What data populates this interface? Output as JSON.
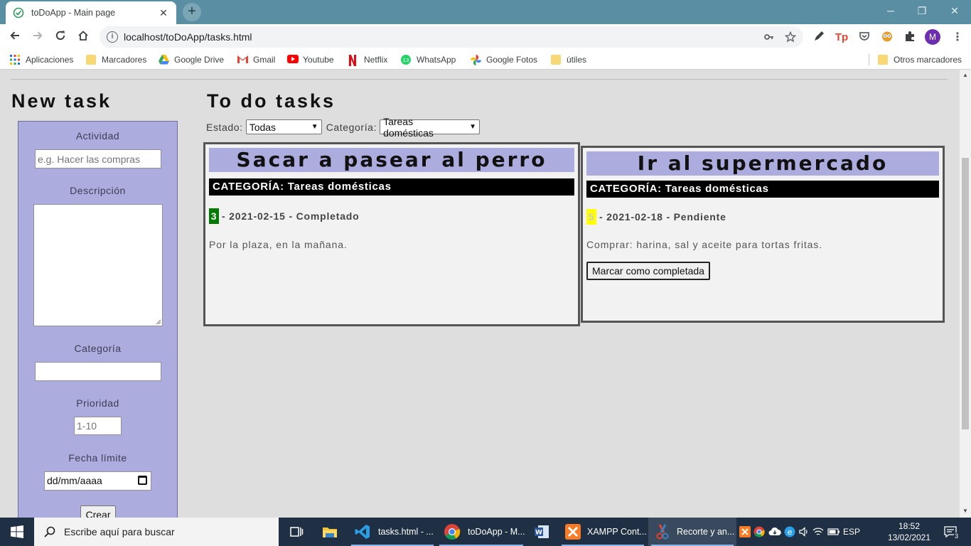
{
  "browser": {
    "tab_title": "toDoApp - Main page",
    "tab_close": "✕",
    "new_tab": "+",
    "url": "localhost/toDoApp/tasks.html",
    "avatar_letter": "M",
    "window_controls": {
      "minimize": "─",
      "maximize": "❐",
      "close": "✕"
    }
  },
  "bookmarks": [
    {
      "label": "Aplicaciones",
      "icon": "apps-grid-icon"
    },
    {
      "label": "Marcadores",
      "icon": "folder-icon"
    },
    {
      "label": "Google Drive",
      "icon": "google-drive-icon"
    },
    {
      "label": "Gmail",
      "icon": "gmail-icon"
    },
    {
      "label": "Youtube",
      "icon": "youtube-icon"
    },
    {
      "label": "Netflix",
      "icon": "netflix-icon"
    },
    {
      "label": "WhatsApp",
      "icon": "whatsapp-icon"
    },
    {
      "label": "Google Fotos",
      "icon": "google-photos-icon"
    },
    {
      "label": "útiles",
      "icon": "folder-icon"
    },
    {
      "label": "Otros marcadores",
      "icon": "folder-icon"
    }
  ],
  "new_task": {
    "heading": "New task",
    "actividad_label": "Actividad",
    "actividad_placeholder": "e.g. Hacer las compras",
    "descripcion_label": "Descripción",
    "categoria_label": "Categoría",
    "prioridad_label": "Prioridad",
    "prioridad_placeholder": "1-10",
    "fecha_label": "Fecha límite",
    "fecha_placeholder": "dd/mm/aaaa",
    "submit_label": "Crear"
  },
  "todo": {
    "heading": "To do tasks",
    "estado_label": "Estado:",
    "estado_value": "Todas",
    "categoria_label": "Categoría:",
    "categoria_value": "Tareas domésticas",
    "tasks": [
      {
        "title": "Sacar a pasear al perro",
        "category": "CATEGORÍA: Tareas domésticas",
        "priority": "3",
        "priority_color": "#007a00",
        "priority_text_color": "#ffffff",
        "date_status": "- 2021-02-15 - Completado",
        "description": "Por la plaza, en la mañana."
      },
      {
        "title": "Ir al supermercado",
        "category": "CATEGORÍA: Tareas domésticas",
        "priority": "5",
        "priority_color": "#ffff00",
        "priority_text_color": "#cccccc",
        "date_status": "- 2021-02-18 - Pendiente",
        "description": "Comprar: harina, sal y aceite para tortas fritas.",
        "action_label": "Marcar como completada"
      }
    ]
  },
  "taskbar": {
    "search_placeholder": "Escribe aquí para buscar",
    "apps": [
      {
        "label": "tasks.html - ...",
        "icon": "vscode-icon"
      },
      {
        "label": "toDoApp - M...",
        "icon": "chrome-icon"
      },
      {
        "label": "XAMPP Cont...",
        "icon": "xampp-icon"
      },
      {
        "label": "Recorte y an...",
        "icon": "snip-sketch-icon"
      }
    ],
    "language": "ESP",
    "time": "18:52",
    "date": "13/02/2021",
    "notification_count": "3"
  },
  "colors": {
    "tabstrip": "#5a8fa3",
    "form_panel": "#acacdf",
    "card_title_bg": "#acacdf",
    "page_bg": "#dedede"
  }
}
